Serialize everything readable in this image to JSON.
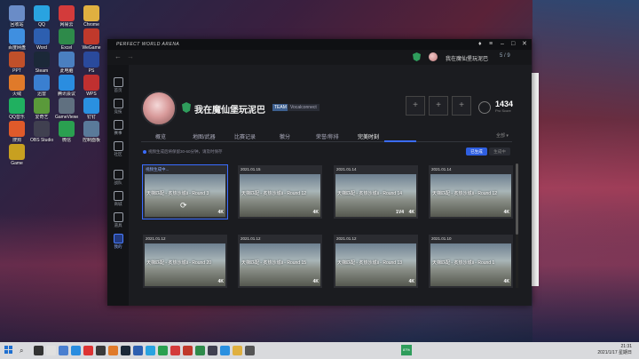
{
  "window": {
    "brand": "PERFECT WORLD ARENA",
    "username": "我在魔仙堡玩泥巴",
    "msg_count": "5 / 9"
  },
  "sidebar": {
    "items": [
      {
        "label": "首页"
      },
      {
        "label": "竞技"
      },
      {
        "label": "赛事"
      },
      {
        "label": "社区"
      },
      {
        "label": "战队"
      },
      {
        "label": "商城"
      },
      {
        "label": "道具"
      },
      {
        "label": "我的"
      }
    ]
  },
  "profile": {
    "name": "我在魔仙堡玩泥巴",
    "team_tag": "TEAM",
    "team_name": "Vocalconnect",
    "score": "1434",
    "score_sub": "Pro Score"
  },
  "tabs": {
    "items": [
      {
        "label": "概览"
      },
      {
        "label": "地图/武器"
      },
      {
        "label": "比赛记录"
      },
      {
        "label": "徽分"
      },
      {
        "label": "荣誉/称排"
      },
      {
        "label": "完美时刻"
      }
    ],
    "all": "全部 ▾"
  },
  "notice": "视频生成后将保留30-60分钟，请及时保存",
  "seg": {
    "a": "已生成",
    "b": "生成中"
  },
  "cards": [
    {
      "date": "视频生成中...",
      "title": "天梯匹配 - 炙热沙城Ⅱ - Round 3",
      "res": "4K",
      "tw": ""
    },
    {
      "date": "2021.01.15",
      "title": "天梯匹配 - 炙热沙城Ⅱ - Round 12",
      "res": "4K",
      "tw": ""
    },
    {
      "date": "2021.01.14",
      "title": "天梯匹配 - 炙热沙城Ⅱ - Round 14",
      "res": "4K",
      "tw": "1V4"
    },
    {
      "date": "2021.01.14",
      "title": "天梯匹配 - 炙热沙城Ⅱ - Round 12",
      "res": "4K",
      "tw": ""
    },
    {
      "date": "2021.01.12",
      "title": "天梯匹配 - 炙热沙城Ⅱ - Round 20",
      "res": "4K",
      "tw": ""
    },
    {
      "date": "2021.01.12",
      "title": "天梯匹配 - 炙热沙城Ⅱ - Round 15",
      "res": "4K",
      "tw": ""
    },
    {
      "date": "2021.01.12",
      "title": "天梯匹配 - 炙热沙城Ⅱ - Round 13",
      "res": "4K",
      "tw": ""
    },
    {
      "date": "2021.01.10",
      "title": "天梯匹配 - 炙热沙城Ⅱ - Round 1",
      "res": "4K",
      "tw": ""
    }
  ],
  "desktop_icons": [
    "回收站",
    "QQ",
    "网易云",
    "Chrome",
    "百度网盘",
    "Word",
    "Excel",
    "WeGame",
    "PPT",
    "Steam",
    "此电脑",
    "PS",
    "火绒",
    "迅雷",
    "腾讯会议",
    "WPS",
    "QQ音乐",
    "爱奇艺",
    "GameViewer",
    "钉钉",
    "搜狗",
    "OBS Studio",
    "微信",
    "控制面板",
    "Game"
  ],
  "taskbar": {
    "battery": "87%",
    "time": "21:31",
    "date": "2021/1/17 星期日"
  },
  "colors": {
    "accent": "#3a6cff",
    "win_bg": "#1b1c20",
    "shield": "#2f9d5c"
  }
}
